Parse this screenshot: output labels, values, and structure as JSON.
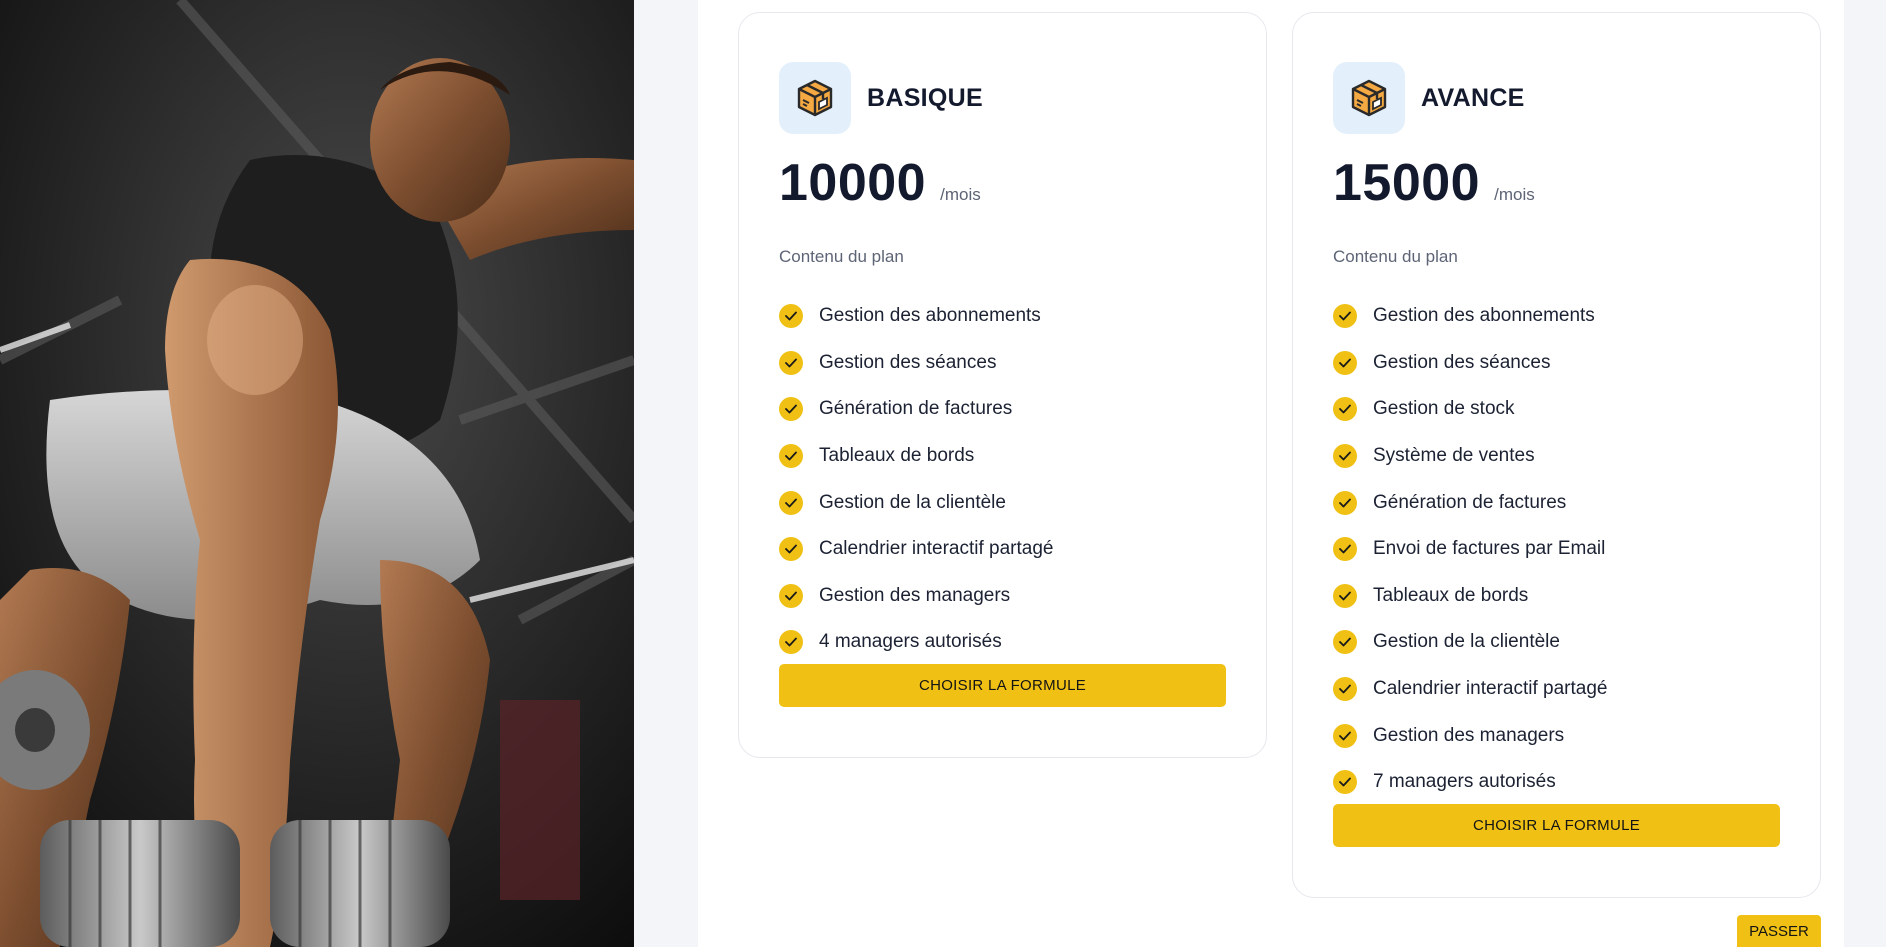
{
  "colors": {
    "accent": "#f0c114",
    "icon_bg": "#e3f0fc",
    "text_dark": "#141a2e",
    "text_muted": "#5d6475",
    "page_bg": "#f3f5f9"
  },
  "hero_image": {
    "icon": "bodybuilder-photo"
  },
  "plans": [
    {
      "icon": "package-box-icon",
      "name": "BASIQUE",
      "price": "10000",
      "period": "/mois",
      "subtitle": "Contenu du plan",
      "features": [
        "Gestion des abonnements",
        "Gestion des séances",
        "Génération de factures",
        "Tableaux de bords",
        "Gestion de la clientèle",
        "Calendrier interactif partagé",
        "Gestion des managers",
        "4 managers autorisés"
      ],
      "button_label": "CHOISIR LA FORMULE"
    },
    {
      "icon": "package-box-icon",
      "name": "AVANCE",
      "price": "15000",
      "period": "/mois",
      "subtitle": "Contenu du plan",
      "features": [
        "Gestion des abonnements",
        "Gestion des séances",
        "Gestion de stock",
        "Système de ventes",
        "Génération de factures",
        "Envoi de factures par Email",
        "Tableaux de bords",
        "Gestion de la clientèle",
        "Calendrier interactif partagé",
        "Gestion des managers",
        "7 managers autorisés"
      ],
      "button_label": "CHOISIR LA FORMULE"
    }
  ],
  "skip_button_label": "PASSER"
}
